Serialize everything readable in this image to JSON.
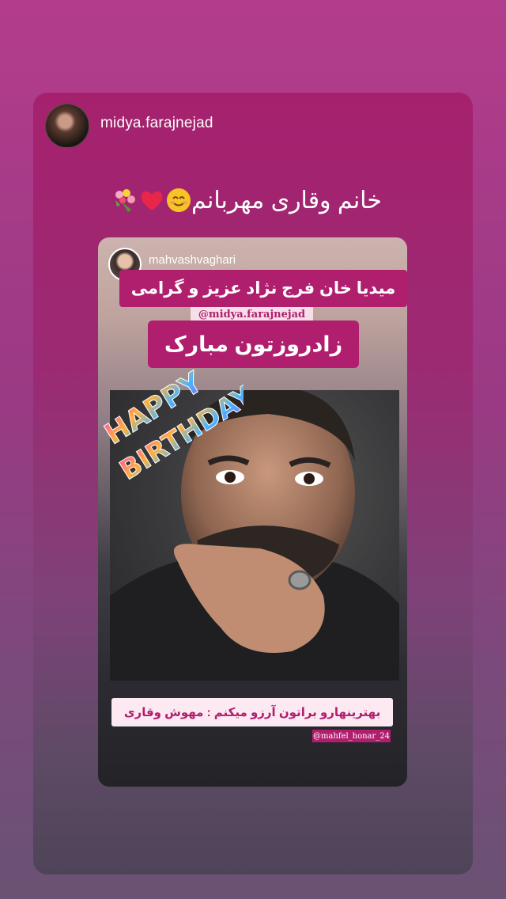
{
  "story": {
    "poster_username": "midya.farajnejad",
    "caption_text": "خانم وقاری مهربانم",
    "caption_emojis": [
      "smiling-face-emoji",
      "red-heart-emoji",
      "bouquet-emoji"
    ]
  },
  "shared_post": {
    "username": "mahvashvaghari",
    "banner_line1": "میدیا خان  فرج نژاد عزیز و گرامی",
    "mention": "@midya.farajnejad",
    "banner_line2": "زادروزتون مبارک",
    "birthday_art_word1": "HAPPY",
    "birthday_art_word2": "BIRTHDAY",
    "wish_text": "بهترینهارو براتون آرزو میکنم  :  مهوش وقاری",
    "page_tag": "@mahfel_honar_24"
  },
  "colors": {
    "accent_magenta": "#b01e6e",
    "story_background": "#a5216e",
    "wish_box_background": "#fde9f2"
  }
}
